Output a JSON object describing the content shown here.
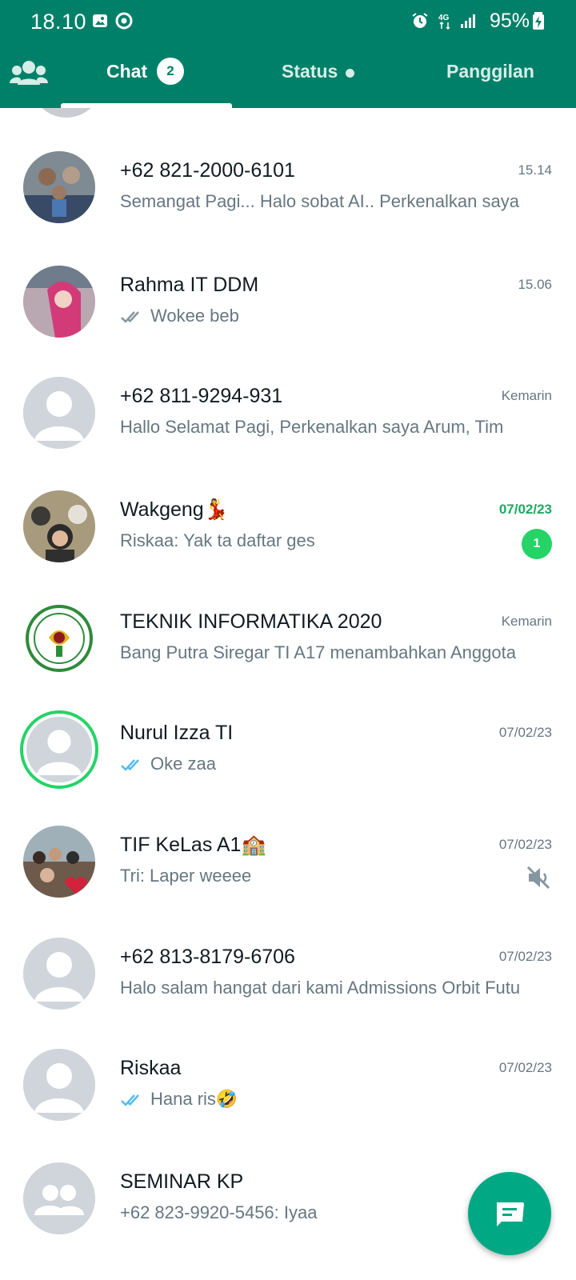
{
  "status_bar": {
    "time": "18.10",
    "battery": "95%",
    "icons": [
      "gallery-icon",
      "sync-icon",
      "alarm-icon",
      "4g-icon",
      "signal-icon",
      "battery-charging-icon"
    ]
  },
  "tabs": {
    "community_icon": "community-icon",
    "chat_label": "Chat",
    "chat_badge": "2",
    "status_label": "Status",
    "calls_label": "Panggilan"
  },
  "chats": [
    {
      "name": "+62 821-2000-6101",
      "time": "15.14",
      "preview": "Semangat Pagi...  Halo sobat AI.. Perkenalkan saya",
      "avatar": "photo"
    },
    {
      "name": "Rahma IT DDM",
      "time": "15.06",
      "preview": "Wokee beb",
      "ticks": "read-grey",
      "avatar": "photo"
    },
    {
      "name": "+62 811-9294-931",
      "time": "Kemarin",
      "preview": "Hallo Selamat Pagi,  Perkenalkan saya Arum, Tim",
      "avatar": "default-person"
    },
    {
      "name": "Wakgeng💃",
      "time": "07/02/23",
      "preview": "Riskaa: Yak ta daftar ges",
      "unread": "1",
      "avatar": "photo"
    },
    {
      "name": "TEKNIK INFORMATIKA 2020",
      "time": "Kemarin",
      "preview": "Bang Putra Siregar TI A17 menambahkan Anggota",
      "avatar": "logo"
    },
    {
      "name": "Nurul Izza TI",
      "time": "07/02/23",
      "preview": "Oke zaa",
      "ticks": "read-blue",
      "avatar": "default-person",
      "status_ring": true
    },
    {
      "name": "TIF KeLas A1🏫",
      "time": "07/02/23",
      "preview": "Tri: Laper weeee",
      "muted": true,
      "avatar": "photo"
    },
    {
      "name": "+62 813-8179-6706",
      "time": "07/02/23",
      "preview": "Halo salam hangat dari kami Admissions Orbit Futu",
      "avatar": "default-person"
    },
    {
      "name": "Riskaa",
      "time": "07/02/23",
      "preview": "Hana ris🤣",
      "ticks": "read-blue",
      "avatar": "default-person"
    },
    {
      "name": "SEMINAR KP",
      "time": "",
      "preview": "+62 823-9920-5456: Iyaa",
      "avatar": "default-group"
    }
  ],
  "colors": {
    "header": "#008069",
    "accent": "#25d366",
    "fab": "#00a884",
    "read_tick": "#53bdeb"
  },
  "fab_icon": "new-chat-icon"
}
